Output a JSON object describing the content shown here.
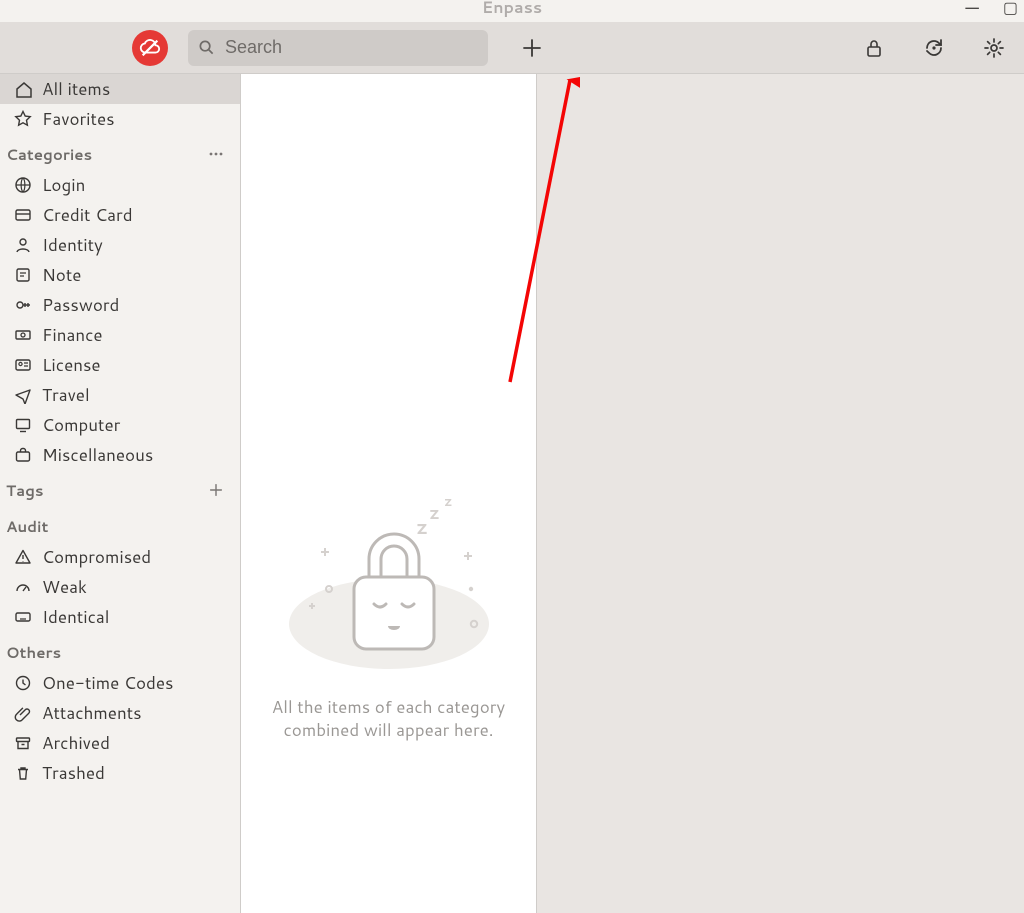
{
  "window": {
    "title": "Enpass"
  },
  "toolbar": {
    "search_placeholder": "Search"
  },
  "sidebar": {
    "top": [
      {
        "id": "all-items",
        "label": "All items",
        "icon": "home"
      },
      {
        "id": "favorites",
        "label": "Favorites",
        "icon": "star"
      }
    ],
    "categories_header": "Categories",
    "categories": [
      {
        "id": "login",
        "label": "Login",
        "icon": "globe"
      },
      {
        "id": "credit-card",
        "label": "Credit Card",
        "icon": "card"
      },
      {
        "id": "identity",
        "label": "Identity",
        "icon": "person"
      },
      {
        "id": "note",
        "label": "Note",
        "icon": "note"
      },
      {
        "id": "password",
        "label": "Password",
        "icon": "key"
      },
      {
        "id": "finance",
        "label": "Finance",
        "icon": "cash"
      },
      {
        "id": "license",
        "label": "License",
        "icon": "idcard"
      },
      {
        "id": "travel",
        "label": "Travel",
        "icon": "plane"
      },
      {
        "id": "computer",
        "label": "Computer",
        "icon": "monitor"
      },
      {
        "id": "miscellaneous",
        "label": "Miscellaneous",
        "icon": "briefcase"
      }
    ],
    "tags_header": "Tags",
    "audit_header": "Audit",
    "audit": [
      {
        "id": "compromised",
        "label": "Compromised",
        "icon": "warn"
      },
      {
        "id": "weak",
        "label": "Weak",
        "icon": "gauge"
      },
      {
        "id": "identical",
        "label": "Identical",
        "icon": "keyboard"
      }
    ],
    "others_header": "Others",
    "others": [
      {
        "id": "one-time-codes",
        "label": "One-time Codes",
        "icon": "clock"
      },
      {
        "id": "attachments",
        "label": "Attachments",
        "icon": "paperclip"
      },
      {
        "id": "archived",
        "label": "Archived",
        "icon": "archive"
      },
      {
        "id": "trashed",
        "label": "Trashed",
        "icon": "trash"
      }
    ]
  },
  "list": {
    "empty_line1": "All the items of each category",
    "empty_line2": "combined will appear here."
  }
}
